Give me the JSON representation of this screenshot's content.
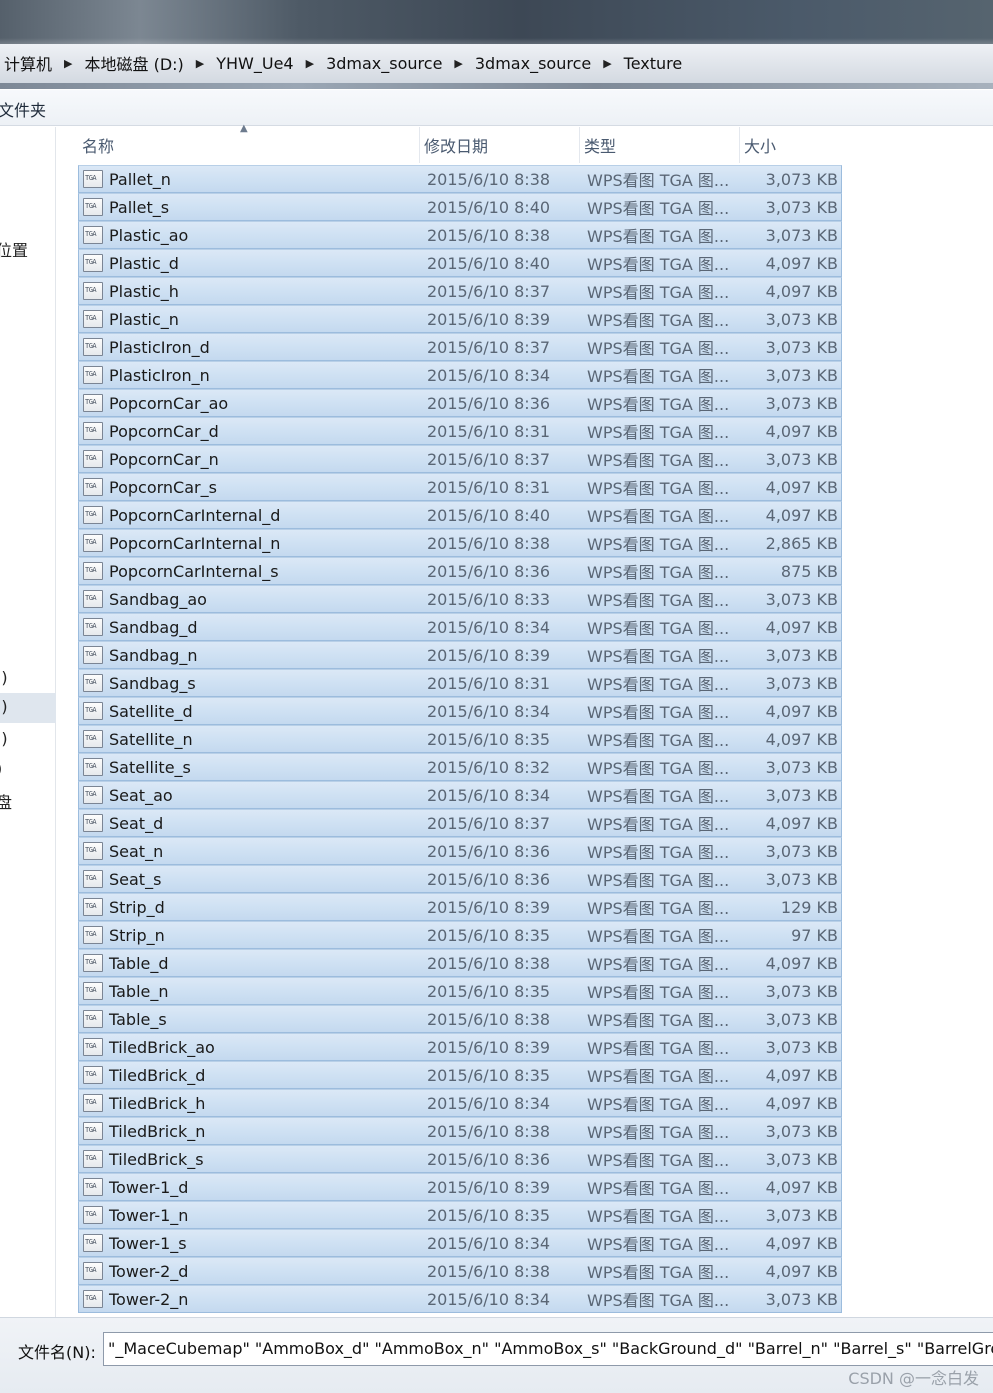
{
  "breadcrumb": [
    "计算机",
    "本地磁盘 (D:)",
    "YHW_Ue4",
    "3dmax_source",
    "3dmax_source",
    "Texture"
  ],
  "command_bar": {
    "new_folder": "文件夹"
  },
  "nav_pane": {
    "items": [
      {
        "label": "位置"
      },
      {
        "label": ":)"
      },
      {
        "label": ":)"
      },
      {
        "label": ":)"
      },
      {
        "label": ")"
      },
      {
        "label": "盘"
      }
    ]
  },
  "columns": {
    "name": "名称",
    "date": "修改日期",
    "type": "类型",
    "size": "大小"
  },
  "files": [
    {
      "name": "Pallet_n",
      "date": "2015/6/10 8:38",
      "type": "WPS看图 TGA 图...",
      "size": "3,073 KB"
    },
    {
      "name": "Pallet_s",
      "date": "2015/6/10 8:40",
      "type": "WPS看图 TGA 图...",
      "size": "3,073 KB"
    },
    {
      "name": "Plastic_ao",
      "date": "2015/6/10 8:38",
      "type": "WPS看图 TGA 图...",
      "size": "3,073 KB"
    },
    {
      "name": "Plastic_d",
      "date": "2015/6/10 8:40",
      "type": "WPS看图 TGA 图...",
      "size": "4,097 KB"
    },
    {
      "name": "Plastic_h",
      "date": "2015/6/10 8:37",
      "type": "WPS看图 TGA 图...",
      "size": "4,097 KB"
    },
    {
      "name": "Plastic_n",
      "date": "2015/6/10 8:39",
      "type": "WPS看图 TGA 图...",
      "size": "3,073 KB"
    },
    {
      "name": "PlasticIron_d",
      "date": "2015/6/10 8:37",
      "type": "WPS看图 TGA 图...",
      "size": "3,073 KB"
    },
    {
      "name": "PlasticIron_n",
      "date": "2015/6/10 8:34",
      "type": "WPS看图 TGA 图...",
      "size": "3,073 KB"
    },
    {
      "name": "PopcornCar_ao",
      "date": "2015/6/10 8:36",
      "type": "WPS看图 TGA 图...",
      "size": "3,073 KB"
    },
    {
      "name": "PopcornCar_d",
      "date": "2015/6/10 8:31",
      "type": "WPS看图 TGA 图...",
      "size": "4,097 KB"
    },
    {
      "name": "PopcornCar_n",
      "date": "2015/6/10 8:37",
      "type": "WPS看图 TGA 图...",
      "size": "3,073 KB"
    },
    {
      "name": "PopcornCar_s",
      "date": "2015/6/10 8:31",
      "type": "WPS看图 TGA 图...",
      "size": "4,097 KB"
    },
    {
      "name": "PopcornCarInternal_d",
      "date": "2015/6/10 8:40",
      "type": "WPS看图 TGA 图...",
      "size": "4,097 KB"
    },
    {
      "name": "PopcornCarInternal_n",
      "date": "2015/6/10 8:38",
      "type": "WPS看图 TGA 图...",
      "size": "2,865 KB"
    },
    {
      "name": "PopcornCarInternal_s",
      "date": "2015/6/10 8:36",
      "type": "WPS看图 TGA 图...",
      "size": "875 KB"
    },
    {
      "name": "Sandbag_ao",
      "date": "2015/6/10 8:33",
      "type": "WPS看图 TGA 图...",
      "size": "3,073 KB"
    },
    {
      "name": "Sandbag_d",
      "date": "2015/6/10 8:34",
      "type": "WPS看图 TGA 图...",
      "size": "4,097 KB"
    },
    {
      "name": "Sandbag_n",
      "date": "2015/6/10 8:39",
      "type": "WPS看图 TGA 图...",
      "size": "3,073 KB"
    },
    {
      "name": "Sandbag_s",
      "date": "2015/6/10 8:31",
      "type": "WPS看图 TGA 图...",
      "size": "3,073 KB"
    },
    {
      "name": "Satellite_d",
      "date": "2015/6/10 8:34",
      "type": "WPS看图 TGA 图...",
      "size": "4,097 KB"
    },
    {
      "name": "Satellite_n",
      "date": "2015/6/10 8:35",
      "type": "WPS看图 TGA 图...",
      "size": "4,097 KB"
    },
    {
      "name": "Satellite_s",
      "date": "2015/6/10 8:32",
      "type": "WPS看图 TGA 图...",
      "size": "3,073 KB"
    },
    {
      "name": "Seat_ao",
      "date": "2015/6/10 8:34",
      "type": "WPS看图 TGA 图...",
      "size": "3,073 KB"
    },
    {
      "name": "Seat_d",
      "date": "2015/6/10 8:37",
      "type": "WPS看图 TGA 图...",
      "size": "4,097 KB"
    },
    {
      "name": "Seat_n",
      "date": "2015/6/10 8:36",
      "type": "WPS看图 TGA 图...",
      "size": "3,073 KB"
    },
    {
      "name": "Seat_s",
      "date": "2015/6/10 8:36",
      "type": "WPS看图 TGA 图...",
      "size": "3,073 KB"
    },
    {
      "name": "Strip_d",
      "date": "2015/6/10 8:39",
      "type": "WPS看图 TGA 图...",
      "size": "129 KB"
    },
    {
      "name": "Strip_n",
      "date": "2015/6/10 8:35",
      "type": "WPS看图 TGA 图...",
      "size": "97 KB"
    },
    {
      "name": "Table_d",
      "date": "2015/6/10 8:38",
      "type": "WPS看图 TGA 图...",
      "size": "4,097 KB"
    },
    {
      "name": "Table_n",
      "date": "2015/6/10 8:35",
      "type": "WPS看图 TGA 图...",
      "size": "3,073 KB"
    },
    {
      "name": "Table_s",
      "date": "2015/6/10 8:38",
      "type": "WPS看图 TGA 图...",
      "size": "3,073 KB"
    },
    {
      "name": "TiledBrick_ao",
      "date": "2015/6/10 8:39",
      "type": "WPS看图 TGA 图...",
      "size": "3,073 KB"
    },
    {
      "name": "TiledBrick_d",
      "date": "2015/6/10 8:35",
      "type": "WPS看图 TGA 图...",
      "size": "4,097 KB"
    },
    {
      "name": "TiledBrick_h",
      "date": "2015/6/10 8:34",
      "type": "WPS看图 TGA 图...",
      "size": "4,097 KB"
    },
    {
      "name": "TiledBrick_n",
      "date": "2015/6/10 8:38",
      "type": "WPS看图 TGA 图...",
      "size": "3,073 KB"
    },
    {
      "name": "TiledBrick_s",
      "date": "2015/6/10 8:36",
      "type": "WPS看图 TGA 图...",
      "size": "3,073 KB"
    },
    {
      "name": "Tower-1_d",
      "date": "2015/6/10 8:39",
      "type": "WPS看图 TGA 图...",
      "size": "4,097 KB"
    },
    {
      "name": "Tower-1_n",
      "date": "2015/6/10 8:35",
      "type": "WPS看图 TGA 图...",
      "size": "3,073 KB"
    },
    {
      "name": "Tower-1_s",
      "date": "2015/6/10 8:34",
      "type": "WPS看图 TGA 图...",
      "size": "4,097 KB"
    },
    {
      "name": "Tower-2_d",
      "date": "2015/6/10 8:38",
      "type": "WPS看图 TGA 图...",
      "size": "4,097 KB"
    },
    {
      "name": "Tower-2_n",
      "date": "2015/6/10 8:34",
      "type": "WPS看图 TGA 图...",
      "size": "3,073 KB"
    }
  ],
  "filename_bar": {
    "label": "文件名(N):",
    "value": "\"_MaceCubemap\" \"AmmoBox_d\" \"AmmoBox_n\" \"AmmoBox_s\" \"BackGround_d\" \"Barrel_n\" \"Barrel_s\" \"BarrelGrey_d"
  },
  "watermark": "CSDN @一念白发",
  "colors": {
    "selection": "#cfe1f3",
    "selection_border": "#9cbcdd",
    "header_text": "#4a5a70"
  },
  "icons": {
    "file": "tga-file-icon",
    "breadcrumb_separator": "triangle-right-icon",
    "sort": "sort-up-icon"
  }
}
